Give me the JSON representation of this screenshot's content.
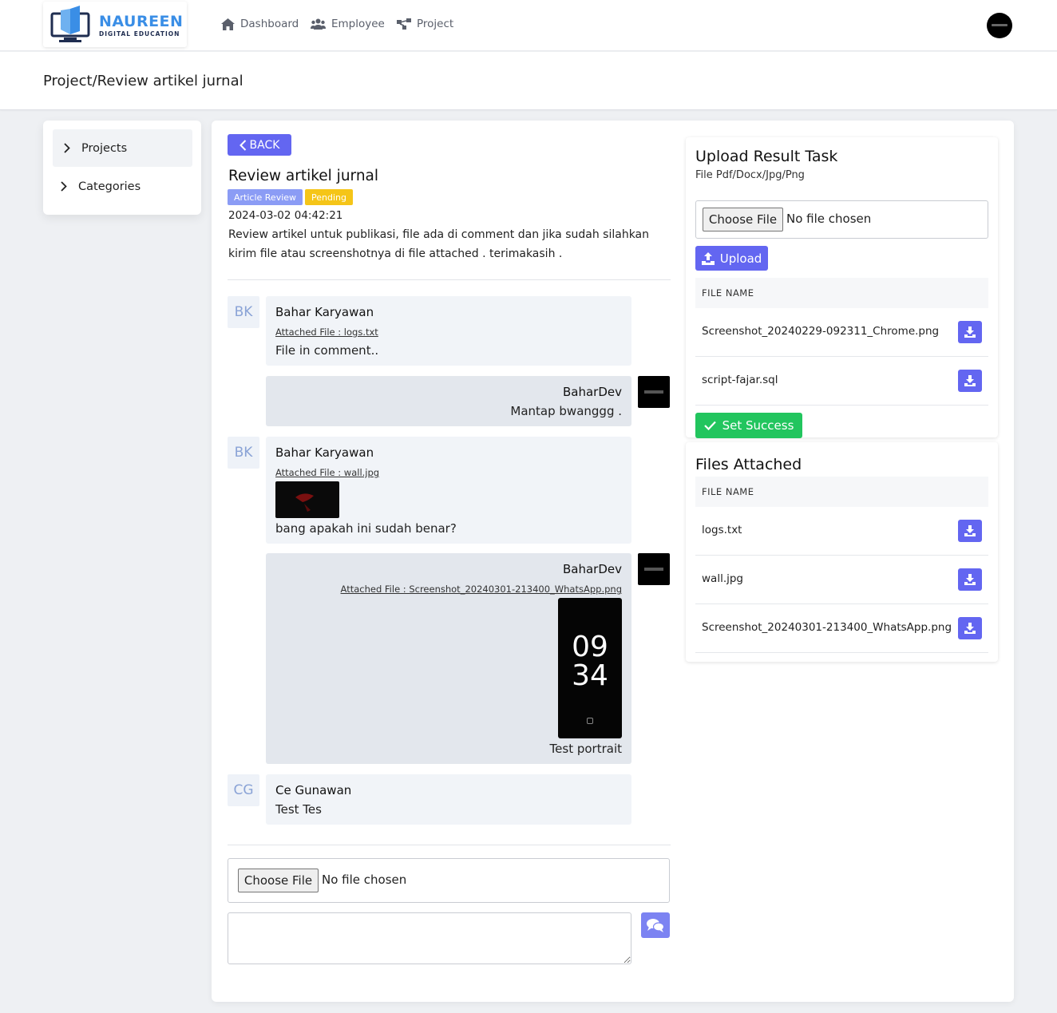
{
  "brand": {
    "name": "NAUREEN",
    "tagline": "DIGITAL EDUCATION"
  },
  "nav": [
    {
      "label": "Dashboard",
      "icon": "home-icon"
    },
    {
      "label": "Employee",
      "icon": "users-icon"
    },
    {
      "label": "Project",
      "icon": "project-icon"
    }
  ],
  "breadcrumb": "Project/Review artikel jurnal",
  "sidebar": {
    "items": [
      {
        "label": "Projects",
        "active": true
      },
      {
        "label": "Categories",
        "active": false
      }
    ]
  },
  "task": {
    "back_label": "BACK",
    "title": "Review artikel jurnal",
    "type_badge": "Article Review",
    "status_badge": "Pending",
    "date": "2024-03-02 04:42:21",
    "description": "Review artikel untuk publikasi, file ada di comment dan jika sudah silahkan kirim file atau screenshotnya di file attached . terimakasih ."
  },
  "comments": [
    {
      "initials": "BK",
      "name": "Bahar Karyawan",
      "attachment": "Attached File : logs.txt",
      "text": "File in comment..",
      "own": false
    },
    {
      "name": "BaharDev",
      "text": "Mantap bwanggg .",
      "own": true
    },
    {
      "initials": "BK",
      "name": "Bahar Karyawan",
      "attachment": "Attached File : wall.jpg",
      "text": "bang apakah ini sudah benar?",
      "own": false
    },
    {
      "name": "BaharDev",
      "attachment": "Attached File : Screenshot_20240301-213400_WhatsApp.png",
      "text": "Test portrait",
      "own": true,
      "phone_clock": {
        "hour": "09",
        "minute": "34"
      }
    },
    {
      "initials": "CG",
      "name": "Ce Gunawan",
      "text": "Test Tes",
      "own": false
    }
  ],
  "comment_form": {
    "choose_label": "Choose File",
    "no_file": "No file chosen",
    "textarea_value": ""
  },
  "upload_panel": {
    "title": "Upload Result Task",
    "subtitle": "File Pdf/Docx/Jpg/Png",
    "choose_label": "Choose File",
    "no_file": "No file chosen",
    "upload_label": "Upload",
    "column_header": "FILE NAME",
    "files": [
      "Screenshot_20240229-092311_Chrome.png",
      "script-fajar.sql"
    ],
    "success_label": "Set Success"
  },
  "attached_panel": {
    "title": "Files Attached",
    "column_header": "FILE NAME",
    "files": [
      "logs.txt",
      "wall.jpg",
      "Screenshot_20240301-213400_WhatsApp.png"
    ]
  },
  "colors": {
    "primary": "#6366f1",
    "success": "#22c55e",
    "pending": "#f5c518",
    "type_badge": "#8b9cf5"
  }
}
